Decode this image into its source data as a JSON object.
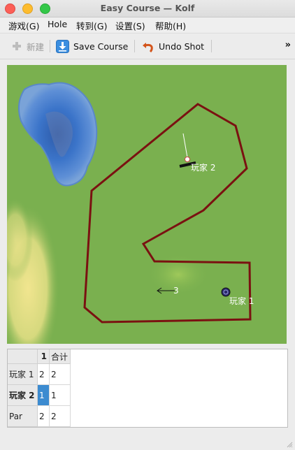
{
  "window": {
    "title": "Easy Course  — Kolf"
  },
  "menubar": {
    "items": [
      "游戏(G)",
      "Hole",
      "转到(G)",
      "设置(S)",
      "帮助(H)"
    ]
  },
  "toolbar": {
    "new_label": "新建",
    "save_course_label": "Save Course",
    "undo_shot_label": "Undo Shot",
    "overflow_label": "»"
  },
  "course": {
    "player2_label": "玩家 2",
    "player1_label": "玩家 1",
    "hole_number_label": "3",
    "wall_color": "#7a1111",
    "grass_color": "#7ab04f"
  },
  "scores": {
    "header": [
      "",
      "1",
      "合计"
    ],
    "rows": [
      {
        "player": "玩家 1",
        "hole1": "2",
        "total": "2"
      },
      {
        "player": "玩家 2",
        "hole1": "1",
        "total": "1"
      },
      {
        "player": "Par",
        "hole1": "2",
        "total": "2"
      }
    ]
  }
}
